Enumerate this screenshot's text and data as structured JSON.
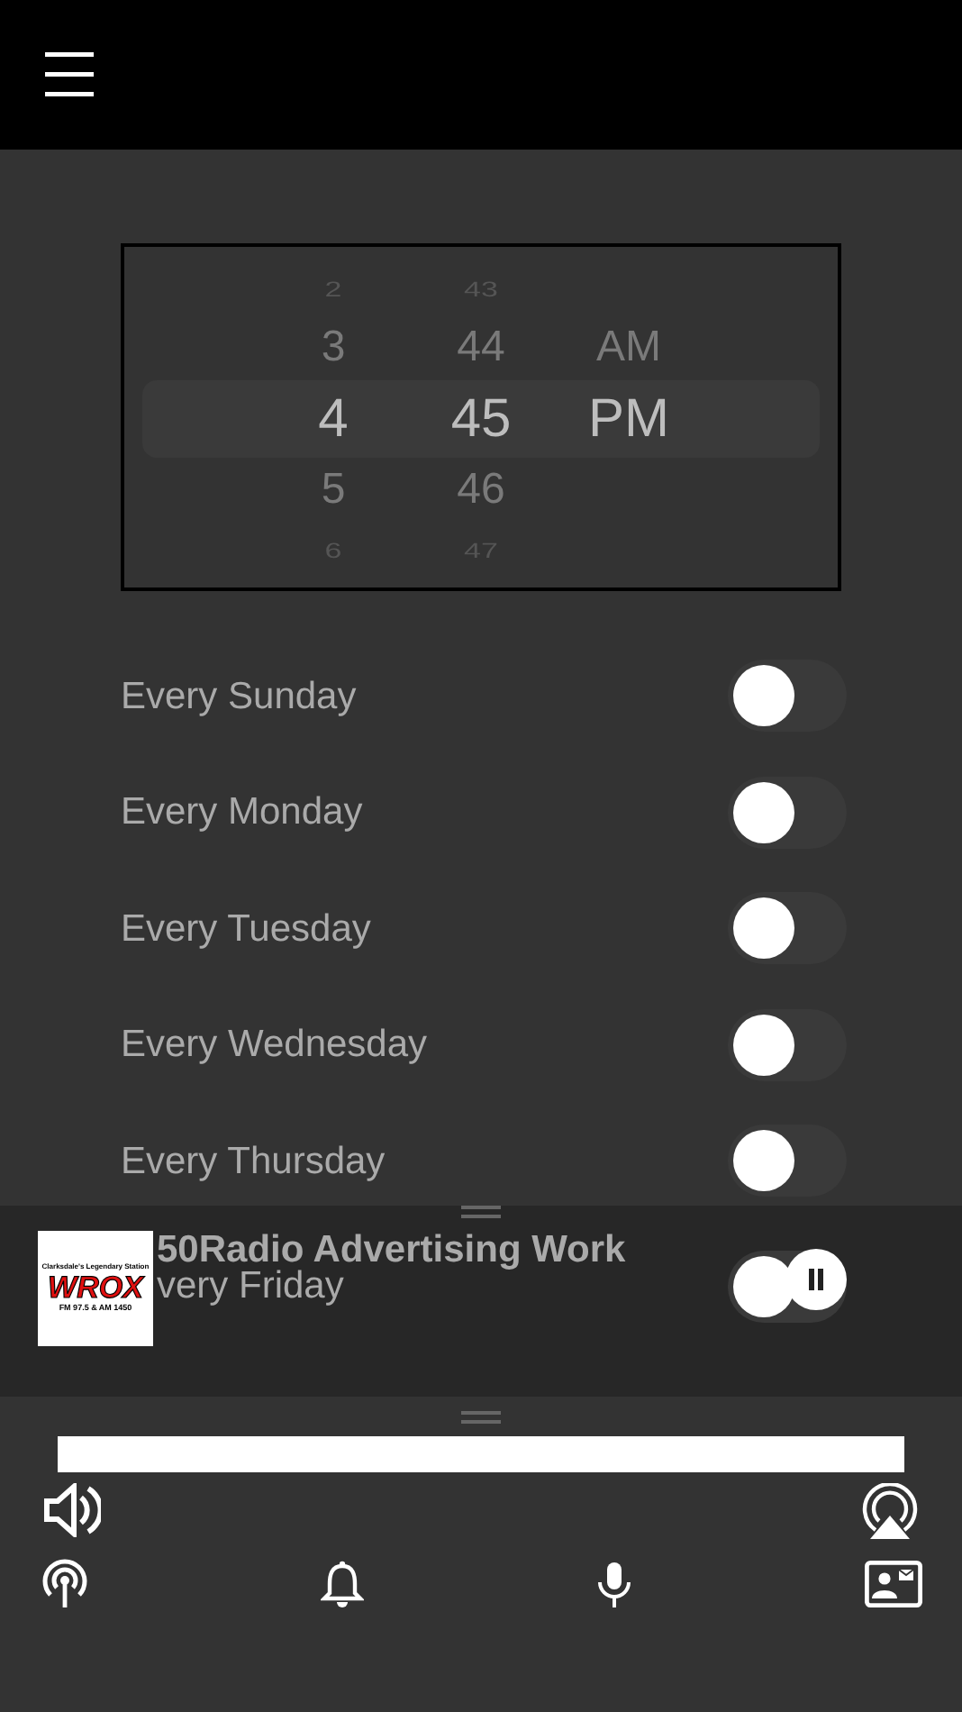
{
  "picker": {
    "columns": [
      {
        "items": [
          {
            "label": "2",
            "selected": false
          },
          {
            "label": "3",
            "selected": false
          },
          {
            "label": "4",
            "selected": true
          },
          {
            "label": "5",
            "selected": false
          },
          {
            "label": "6",
            "selected": false
          }
        ]
      },
      {
        "items": [
          {
            "label": "43",
            "selected": false
          },
          {
            "label": "44",
            "selected": false
          },
          {
            "label": "45",
            "selected": true
          },
          {
            "label": "46",
            "selected": false
          },
          {
            "label": "47",
            "selected": false
          }
        ]
      },
      {
        "items": [
          {
            "label": "AM",
            "selected": false
          },
          {
            "label": "PM",
            "selected": true
          }
        ]
      }
    ]
  },
  "repeat_days": [
    {
      "label": "Every Sunday",
      "on": false
    },
    {
      "label": "Every Monday",
      "on": false
    },
    {
      "label": "Every Tuesday",
      "on": false
    },
    {
      "label": "Every Wednesday",
      "on": false
    },
    {
      "label": "Every Thursday",
      "on": false
    }
  ],
  "mini_player": {
    "title": "50Radio Advertising Work",
    "covered_row": {
      "label": "very Friday",
      "on": false
    },
    "playing": true
  },
  "seek_bar": {
    "level": 1
  },
  "station_logo": {
    "tagline": "Clarksdale's Legendary Station",
    "name": "WROX",
    "frequencies": "FM 97.5 & AM 1450"
  }
}
